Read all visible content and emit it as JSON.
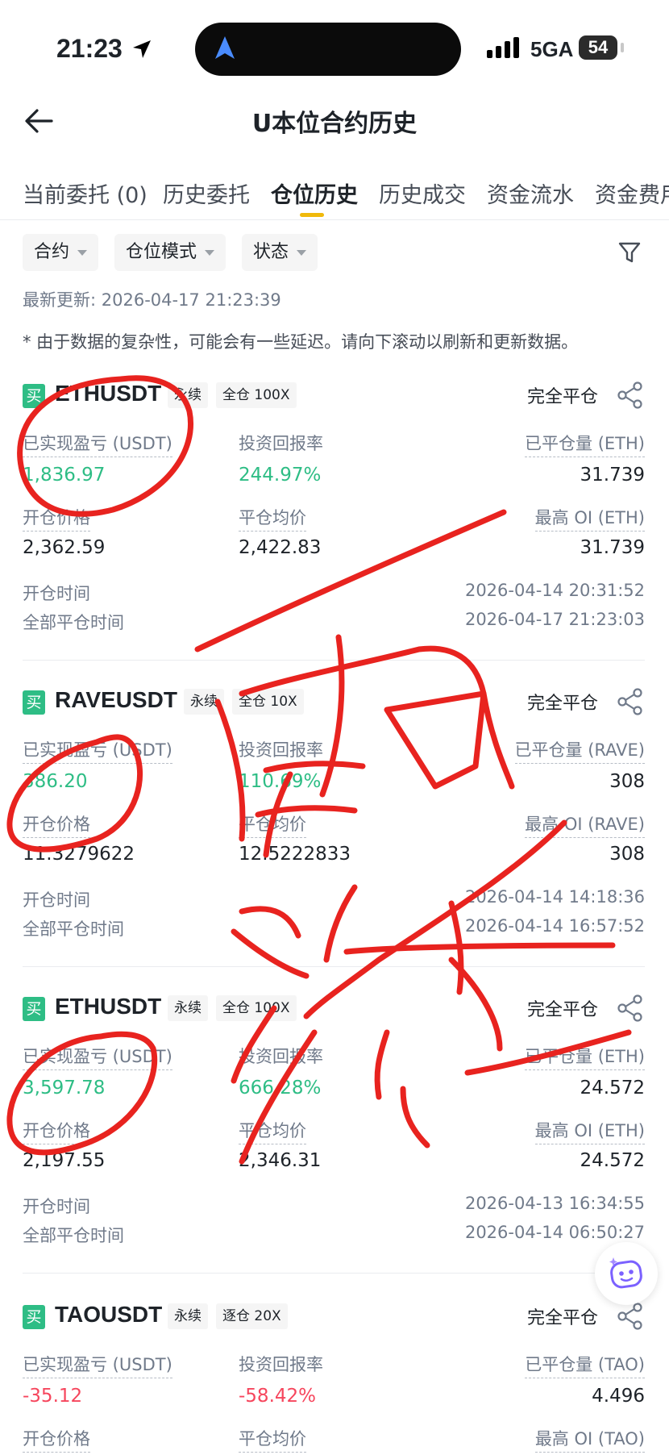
{
  "status_bar": {
    "time": "21:23",
    "network": "5GA",
    "battery": "54"
  },
  "nav": {
    "title": "U本位合约历史"
  },
  "tabs": [
    {
      "label": "当前委托 (0)"
    },
    {
      "label": "历史委托"
    },
    {
      "label": "仓位历史"
    },
    {
      "label": "历史成交"
    },
    {
      "label": "资金流水"
    },
    {
      "label": "资金费用"
    }
  ],
  "filters": [
    {
      "label": "合约"
    },
    {
      "label": "仓位模式"
    },
    {
      "label": "状态"
    }
  ],
  "last_updated": "最新更新: 2026-04-17 21:23:39",
  "notice": "* 由于数据的复杂性，可能会有一些延迟。请向下滚动以刷新和更新数据。",
  "colors": {
    "buy_green": "#2ebd85",
    "sell_red": "#f6465d",
    "accent": "#f0b90b",
    "annotation_red": "#e8231f"
  },
  "labels": {
    "side_buy": "买",
    "perp": "永续",
    "status": "完全平仓",
    "realized_pnl": "已实现盈亏 (USDT)",
    "roi": "投资回报率",
    "entry_price": "开仓价格",
    "avg_close": "平仓均价",
    "open_time": "开仓时间",
    "close_time": "全部平仓时间"
  },
  "positions": [
    {
      "symbol": "ETHUSDT",
      "margin": "全仓 100X",
      "pnl": "1,836.97",
      "roi": "244.97%",
      "closed_qty_label": "已平仓量 (ETH)",
      "closed_qty": "31.739",
      "entry_price": "2,362.59",
      "avg_close": "2,422.83",
      "max_oi_label": "最高 OI (ETH)",
      "max_oi": "31.739",
      "open_time": "2026-04-14 20:31:52",
      "close_time": "2026-04-17 21:23:03"
    },
    {
      "symbol": "RAVEUSDT",
      "margin": "全仓 10X",
      "pnl": "386.20",
      "roi": "110.69%",
      "closed_qty_label": "已平仓量 (RAVE)",
      "closed_qty": "308",
      "entry_price": "11.3279622",
      "avg_close": "12.5222833",
      "max_oi_label": "最高 OI (RAVE)",
      "max_oi": "308",
      "open_time": "2026-04-14 14:18:36",
      "close_time": "2026-04-14 16:57:52"
    },
    {
      "symbol": "ETHUSDT",
      "margin": "全仓 100X",
      "pnl": "3,597.78",
      "roi": "666.28%",
      "closed_qty_label": "已平仓量 (ETH)",
      "closed_qty": "24.572",
      "entry_price": "2,197.55",
      "avg_close": "2,346.31",
      "max_oi_label": "最高 OI (ETH)",
      "max_oi": "24.572",
      "open_time": "2026-04-13 16:34:55",
      "close_time": "2026-04-14 06:50:27"
    },
    {
      "symbol": "TAOUSDT",
      "margin": "逐仓 20X",
      "pnl": "-35.12",
      "roi": "-58.42%",
      "closed_qty_label": "已平仓量 (TAO)",
      "closed_qty": "4.496",
      "entry_price": "",
      "avg_close": "",
      "max_oi_label": "最高 OI (TAO)",
      "max_oi": ""
    }
  ]
}
